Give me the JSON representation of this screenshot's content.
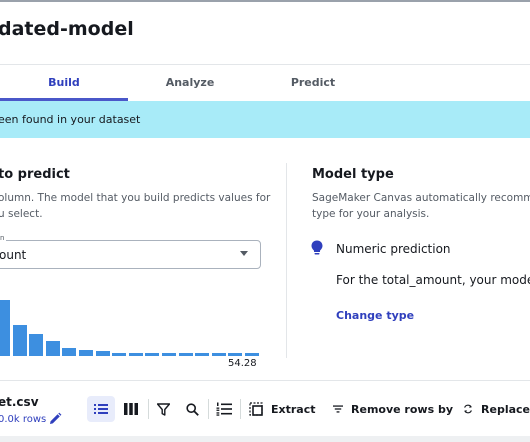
{
  "header": {
    "title": "dated-model"
  },
  "tabs": [
    {
      "label": "Build",
      "active": true
    },
    {
      "label": "Analyze",
      "active": false
    },
    {
      "label": "Predict",
      "active": false
    }
  ],
  "banner": {
    "text": "een found in your dataset"
  },
  "target": {
    "title": "to predict",
    "desc_line1": "olumn. The model that you build predicts values for",
    "desc_line2": "u select.",
    "select_label": "n",
    "select_value": "ount",
    "histogram_label": "54.28",
    "histogram_values": [
      1.0,
      0.55,
      0.4,
      0.27,
      0.15,
      0.11,
      0.09,
      0.06,
      0.06,
      0.06,
      0.06,
      0.06,
      0.06,
      0.06,
      0.06,
      0.06
    ]
  },
  "model_type": {
    "title": "Model type",
    "desc_line1": "SageMaker Canvas automatically recommend",
    "desc_line2": "type for your analysis.",
    "prediction": "Numeric prediction",
    "prediction_desc": "For the total_amount, your model p",
    "change_link": "Change type",
    "icon": "lightbulb-icon"
  },
  "dataset": {
    "file_name": "et.csv",
    "row_count": "0.0k rows"
  },
  "toolbar": {
    "extract_label": "Extract",
    "remove_rows_label": "Remove rows by",
    "replace_label": "Replace"
  },
  "colors": {
    "accent": "#2f3fbd",
    "banner": "#a8ebf8",
    "bar": "#3d8fe0"
  }
}
